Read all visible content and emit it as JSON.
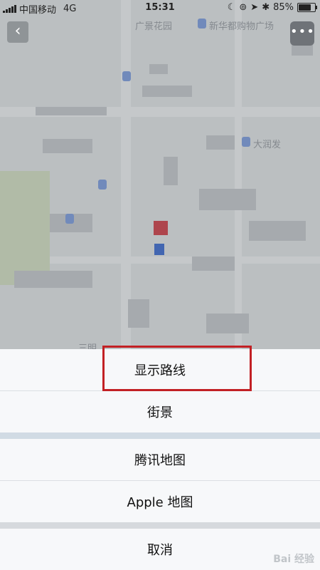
{
  "status_bar": {
    "carrier": "中国移动",
    "network": "4G",
    "time": "15:31",
    "battery_percent": "85%",
    "battery_level": 0.85
  },
  "map": {
    "labels": {
      "guangjing": "广景花园",
      "xinhua": "新华都购物广场",
      "darunfa": "大润发",
      "sanming": "三明"
    },
    "colors": {
      "pin_red": "#c4303a",
      "pin_blue": "#2f5ec4"
    }
  },
  "toolbar": {
    "back_icon": "chevron-left-icon",
    "more_icon": "more-icon"
  },
  "action_sheet": {
    "show_route": "显示路线",
    "street_view": "街景",
    "tencent_map": "腾讯地图",
    "apple_map": "Apple 地图",
    "cancel": "取消"
  },
  "annotation": {
    "highlight_color": "#c22024"
  },
  "watermark": "Bai 经验"
}
